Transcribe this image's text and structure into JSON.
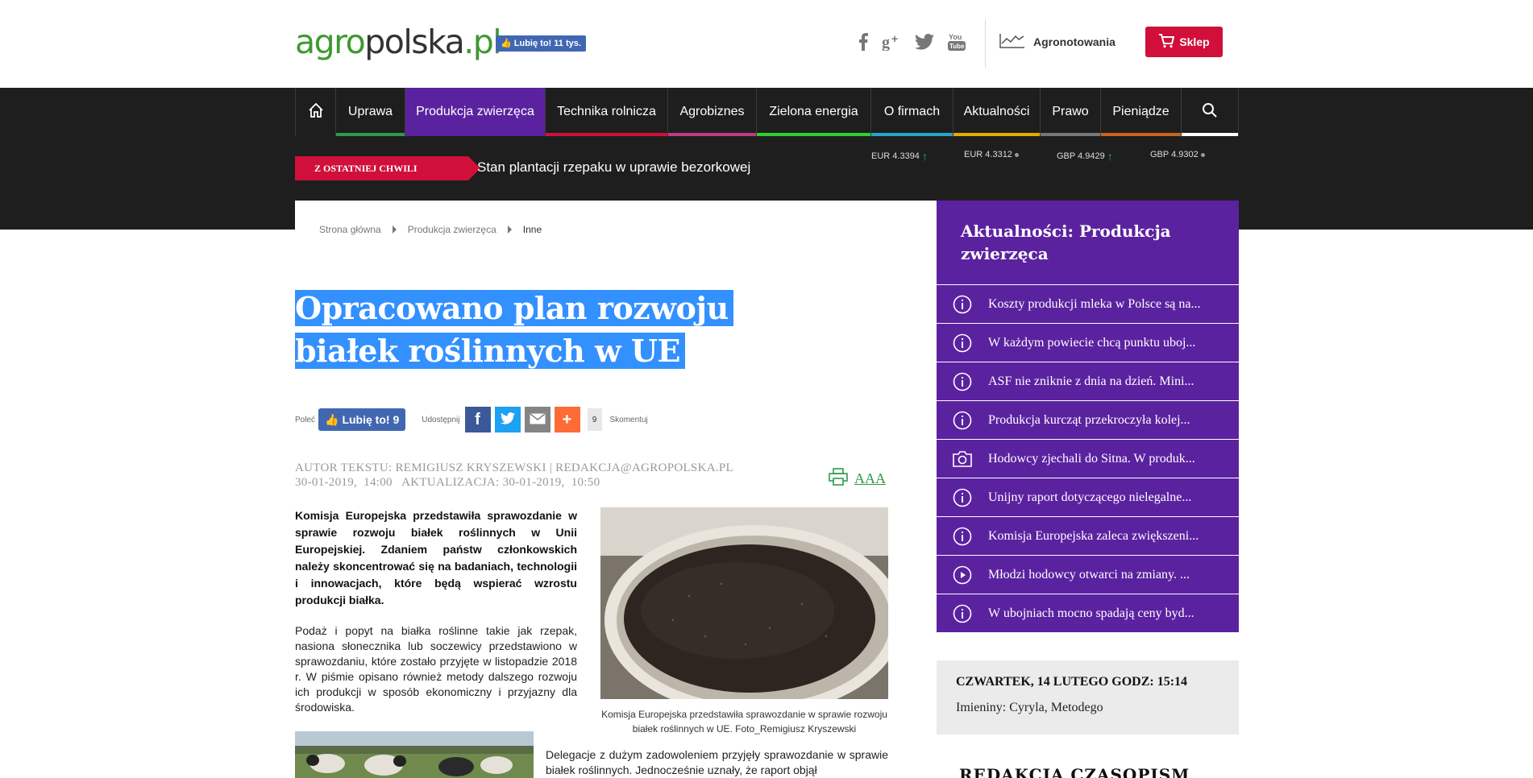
{
  "header": {
    "logo": {
      "agro": "agro",
      "polska": "polska",
      "dot_pl": ".pl"
    },
    "fb_like_label": "Lubię to! 11 tys.",
    "social_icons": [
      "facebook-icon",
      "google-plus-icon",
      "twitter-icon",
      "youtube-icon"
    ],
    "agronotowania_label": "Agronotowania",
    "sklep_label": "Sklep"
  },
  "nav": {
    "items": [
      {
        "label": "Uprawa",
        "color": "#2e9a4a"
      },
      {
        "label": "Produkcja zwierzęca",
        "color": "#5b22a0",
        "active": true
      },
      {
        "label": "Technika rolnicza",
        "color": "#d0103a"
      },
      {
        "label": "Agrobiznes",
        "color": "#c23a84"
      },
      {
        "label": "Zielona energia",
        "color": "#2dd12d"
      },
      {
        "label": "O firmach",
        "color": "#27a7c9"
      },
      {
        "label": "Aktualności",
        "color": "#e8a900"
      },
      {
        "label": "Prawo",
        "color": "#777777"
      },
      {
        "label": "Pieniądze",
        "color": "#c9641c"
      }
    ],
    "search_icon": "search-icon",
    "home_icon": "home-icon"
  },
  "ticker": {
    "badge": "Z OSTATNIEJ CHWILI",
    "headline": "Stan plantacji rzepaku w uprawie bezorkowej",
    "rates": [
      {
        "label": "EUR 4.3394",
        "trend": "up"
      },
      {
        "label": "EUR 4.3312",
        "trend": "flat"
      },
      {
        "label": "GBP 4.9429",
        "trend": "up"
      },
      {
        "label": "GBP 4.9302",
        "trend": "flat"
      }
    ]
  },
  "breadcrumb": {
    "home": "Strona główna",
    "section": "Produkcja zwierzęca",
    "current": "Inne"
  },
  "article": {
    "title": "Opracowano plan rozwoju białek roślinnych w UE",
    "share": {
      "polec_label": "Poleć",
      "like_label": "Lubię to! 9",
      "udostepnij_label": "Udostępnij",
      "share_count": "9",
      "skomentuj_label": "Skomentuj"
    },
    "author_line": "AUTOR TEKSTU: REMIGIUSZ KRYSZEWSKI | REDAKCJA@AGROPOLSKA.PL",
    "date_line": "30-01-2019,  14:00   AKTUALIZACJA: 30-01-2019,  10:50",
    "font_size_label": "AAA",
    "lead": "Komisja Europejska przedstawiła sprawozdanie w sprawie rozwoju białek roślinnych w Unii Europejskiej. Zdaniem państw członkowskich należy skoncentrować się na badaniach, technologii i innowacjach, które będą wspierać wzrostu produkcji białka.",
    "paragraph1": "Podaż i popyt na białka roślinne takie jak rzepak, nasiona słonecznika lub soczewicy przedstawiono w sprawozdaniu, które zostało przyjęte w listopadzie 2018 r. W piśmie opisano również metody dalszego rozwoju ich produkcji w sposób ekonomiczny i przyjazny dla środowiska.",
    "caption": "Komisja Europejska przedstawiła sprawozdanie w sprawie rozwoju białek roślinnych w UE. Foto_Remigiusz Kryszewski",
    "paragraph2": "Delegacje z dużym zadowoleniem przyjęły sprawozdanie w sprawie białek roślinnych. Jednocześnie uznały, że raport objął"
  },
  "sidebar": {
    "title": "Aktualności: Produkcja zwierzęca",
    "items": [
      {
        "icon": "info-icon",
        "label": "Koszty produkcji mleka w Polsce są na..."
      },
      {
        "icon": "info-icon",
        "label": "W każdym powiecie chcą punktu uboj..."
      },
      {
        "icon": "info-icon",
        "label": "ASF nie zniknie z dnia na dzień. Mini..."
      },
      {
        "icon": "info-icon",
        "label": "Produkcja kurcząt przekroczyła kolej..."
      },
      {
        "icon": "camera-icon",
        "label": "Hodowcy zjechali do Sitna. W produk..."
      },
      {
        "icon": "info-icon",
        "label": "Unijny raport dotyczącego nielegalne..."
      },
      {
        "icon": "info-icon",
        "label": "Komisja Europejska zaleca zwiększeni..."
      },
      {
        "icon": "play-icon",
        "label": "Młodzi hodowcy otwarci na zmiany. ..."
      },
      {
        "icon": "info-icon",
        "label": "W ubojniach mocno spadają ceny byd..."
      }
    ],
    "date": "CZWARTEK, 14 LUTEGO GODZ: 15:14",
    "namedays": "Imieniny: Cyryla, Metodego",
    "next_heading": "REDAKCJA CZASOPISM"
  }
}
